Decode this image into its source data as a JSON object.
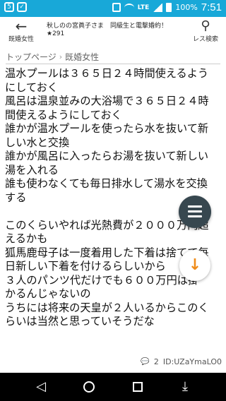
{
  "status_bar": {
    "battery": "100%",
    "time": "7:51",
    "network": "LTE"
  },
  "header": {
    "back_label": "既婚女性",
    "title_line1": "秋しのの宮眞子さま　同級生と電撃婚約！",
    "title_line2": "★291",
    "search_label": "レス検索"
  },
  "breadcrumb": {
    "home": "トップページ",
    "current": "既婚女性"
  },
  "post": {
    "lines": [
      "温水プールは３６５日２４時間使えるよう",
      "にしておく",
      "風呂は温泉並みの大浴場で３６５日２４時",
      "間使えるようにしておく",
      "誰かが温水プールを使ったら水を抜いて新",
      "しい水と交換",
      "誰かが風呂に入ったらお湯を抜いて新しい",
      "湯を入れる",
      "誰も使わなくても毎日排水して湯水を交換",
      "する",
      "",
      "このくらいやれば光熱費が２０００万円超",
      "えるかも",
      "狐馬鹿母子は一度着用した下着は捨てて毎",
      "日新しい下着を付けるらしいから",
      "３人のパンツ代だけでも６００万円は掛",
      "かるんじゃないの",
      "うちには将来の天皇が２人いるからこのく",
      "らいは当然と思っていそうだな"
    ],
    "reply_count": "2",
    "id_text": "ID:UZaYmaLO0"
  }
}
